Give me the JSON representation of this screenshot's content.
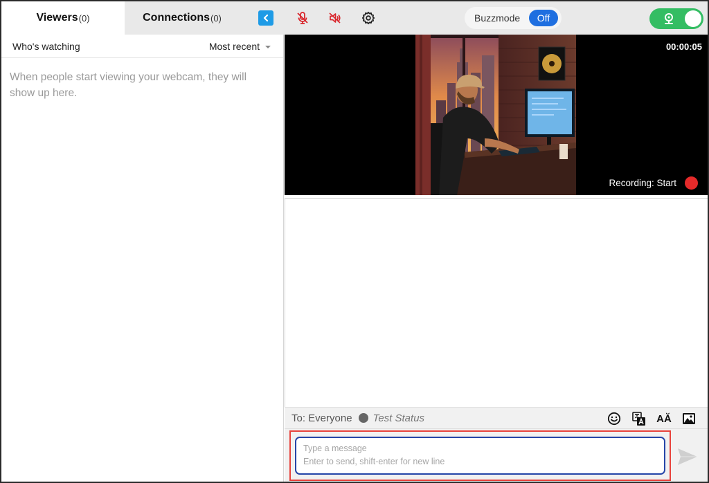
{
  "tabs": {
    "viewers_label": "Viewers",
    "viewers_count": "(0)",
    "connections_label": "Connections",
    "connections_count": "(0)"
  },
  "toolbar": {
    "icons": [
      "chevron-left-icon",
      "mic-muted-icon",
      "speaker-muted-icon",
      "gear-icon"
    ],
    "muted_color": "#d9262c",
    "accent": "#1e9be6"
  },
  "buzzmode": {
    "label": "Buzzmode",
    "state": "Off",
    "state_color": "#1f6fe0"
  },
  "webcam_toggle": {
    "on": true,
    "color": "#34bd63"
  },
  "viewers_panel": {
    "heading": "Who's watching",
    "sort_label": "Most recent",
    "empty_message": "When people start viewing your webcam, they will show up here."
  },
  "video": {
    "timer": "00:00:05",
    "recording_label": "Recording: Start",
    "record_color": "#e52a2a"
  },
  "chat_bar": {
    "to_label": "To: Everyone",
    "status_text": "Test Status",
    "tools": [
      "emoji-icon",
      "translate-icon",
      "font-size-icon",
      "image-icon"
    ],
    "font_tool_text": "AĂ"
  },
  "composer": {
    "placeholder": "Type a message\nEnter to send, shift-enter for new line",
    "value": ""
  }
}
